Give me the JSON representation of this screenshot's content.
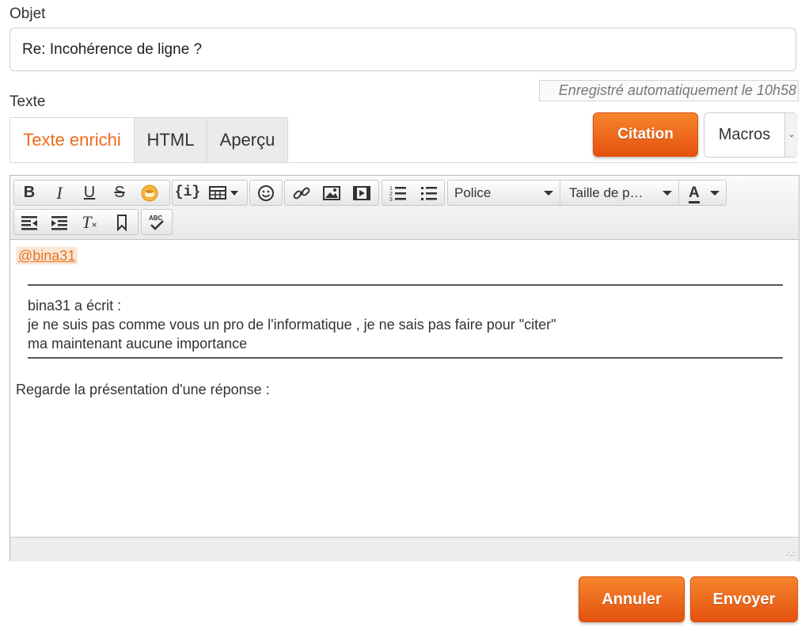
{
  "subject": {
    "label": "Objet",
    "value": "Re: Incohérence de ligne ?"
  },
  "autosave": "Enregistré automatiquement le 10h58",
  "text_label": "Texte",
  "tabs": [
    {
      "label": "Texte enrichi",
      "active": true
    },
    {
      "label": "HTML",
      "active": false
    },
    {
      "label": "Aperçu",
      "active": false
    }
  ],
  "citation_label": "Citation",
  "macros": {
    "label": "Macros"
  },
  "toolbar": {
    "font_combo": "Police",
    "size_combo": "Taille de p…",
    "color_letter": "A",
    "icons": [
      "bold-icon",
      "italic-icon",
      "underline-icon",
      "strikethrough-icon",
      "emoji-plugin-icon",
      "code-icon",
      "table-icon",
      "smiley-icon",
      "link-icon",
      "image-icon",
      "video-icon",
      "numbered-list-icon",
      "bulleted-list-icon",
      "text-color-icon",
      "outdent-icon",
      "indent-icon",
      "clear-format-icon",
      "bookmark-icon",
      "spellcheck-icon"
    ]
  },
  "content": {
    "mention": "@bina31",
    "quote_lines": [
      "bina31 a écrit :",
      "je ne suis pas comme vous un pro de l'informatique , je ne sais pas faire pour \"citer\"",
      "ma maintenant aucune importance"
    ],
    "after": "Regarde la présentation d'une réponse :"
  },
  "buttons": {
    "cancel": "Annuler",
    "send": "Envoyer"
  },
  "colors": {
    "accent": "#f06b1e",
    "button_gradient_top": "#f6852d",
    "button_gradient_bottom": "#e4520f"
  }
}
